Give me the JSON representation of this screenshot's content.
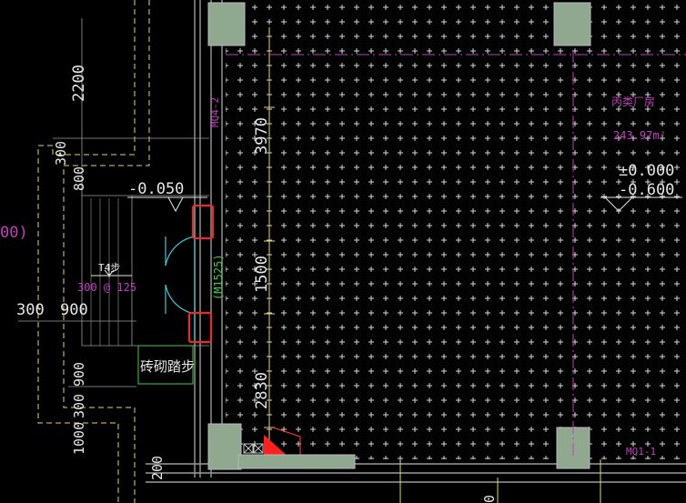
{
  "colors": {
    "background": "#000000",
    "dimension": "#e6d36a",
    "text_white": "#e6e6e6",
    "wall_gray": "#9a9a9a",
    "column_fill": "#8fa88f",
    "hatch_plus": "#d8d8d8",
    "magenta": "#c040c0",
    "cyan": "#3ec8d8",
    "green": "#3ecf3e",
    "red": "#ff2020"
  },
  "dimensions": {
    "dim_2200": "2200",
    "dim_300_top": "300",
    "dim_800": "800",
    "dim_300_h": "300",
    "dim_900_h": "900",
    "dim_900_v": "900",
    "dim_300_v": "300",
    "dim_1000": "1000",
    "dim_200": "200",
    "dim_3970": "3970",
    "dim_1500": "1500",
    "dim_2830": "2830",
    "dim_0_bottom": "0"
  },
  "levels": {
    "left_level": "-0.050",
    "right_level_1": "±0.000",
    "right_level_2": "-0.600",
    "left_paren": "00)"
  },
  "labels": {
    "stair_steps": "T4步",
    "stair_spec": "300 @ 125",
    "brick_steps": "砖砌踏步",
    "door_tag": "(M1525)",
    "room_name": "丙类厂房",
    "room_area": "243.97m²",
    "wall_tag_left": "MQ4-2",
    "wall_tag_bottom": "MQ1-1"
  }
}
